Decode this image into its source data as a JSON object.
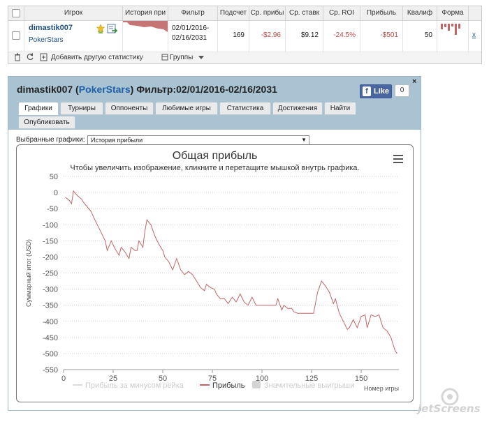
{
  "table": {
    "headers": [
      "Игрок",
      "История при",
      "Фильтр",
      "Подсчет",
      "Ср. прибы",
      "Ср. ставк",
      "Ср. ROI",
      "Прибыль",
      "Квалиф",
      "Форма"
    ],
    "row": {
      "player": "dimastik007",
      "site": "PokerStars",
      "filter_line1": "02/01/2016-",
      "filter_line2": "02/16/2031",
      "count": "169",
      "avg_profit": "-$2.96",
      "avg_stake": "$9.12",
      "avg_roi": "-24.5%",
      "profit": "-$501",
      "qual": "50",
      "remove": "x"
    },
    "footer": {
      "add_stat": "Добавить другую статистику",
      "groups": "Группы"
    }
  },
  "window": {
    "title_player": "dimastik007",
    "title_open": " (",
    "title_site": "PokerStars",
    "title_close": ") Фильтр:02/01/2016-02/16/2031",
    "fb_like": "Like",
    "fb_count": "0",
    "close": "×",
    "tabs": [
      "Графики",
      "Турниры",
      "Оппоненты",
      "Любимые игры",
      "Статистика",
      "Достижения",
      "Найти",
      "Опубликовать"
    ],
    "select_label": "Выбранные графики:",
    "select_value": "История прибыли"
  },
  "colors": {
    "series_line": "#c06666",
    "header_bg": "#a9c3d3",
    "accent_link": "#1e5fa8"
  },
  "chart_data": {
    "type": "line",
    "title": "Общая прибыль",
    "subtitle": "Чтобы увеличить изображение, кликните и перетащите мышкой внутрь графика.",
    "ylabel": "Суммарный итог (USD)",
    "xlabel": "Номер игры",
    "xlim": [
      0,
      169
    ],
    "ylim": [
      -550,
      50
    ],
    "xticks": [
      0,
      25,
      50,
      75,
      100,
      125,
      150
    ],
    "yticks": [
      50,
      0,
      -50,
      -100,
      -150,
      -200,
      -250,
      -300,
      -350,
      -400,
      -450,
      -500,
      -550
    ],
    "grid": "horizontal dotted",
    "legend": "bottom-center",
    "legend_items": [
      {
        "name": "Прибыль за минусом рейка",
        "visible": false
      },
      {
        "name": "Прибыль",
        "visible": true
      },
      {
        "name": "Значительные выигрыши",
        "visible": false
      }
    ],
    "series": [
      {
        "name": "Прибыль",
        "points": [
          [
            1,
            -15
          ],
          [
            3,
            -25
          ],
          [
            4,
            -35
          ],
          [
            5,
            5
          ],
          [
            7,
            -10
          ],
          [
            9,
            -20
          ],
          [
            10,
            -30
          ],
          [
            12,
            -45
          ],
          [
            14,
            -60
          ],
          [
            15,
            -75
          ],
          [
            17,
            -100
          ],
          [
            19,
            -125
          ],
          [
            21,
            -150
          ],
          [
            22,
            -180
          ],
          [
            24,
            -150
          ],
          [
            26,
            -175
          ],
          [
            28,
            -195
          ],
          [
            29,
            -170
          ],
          [
            31,
            -185
          ],
          [
            33,
            -205
          ],
          [
            34,
            -170
          ],
          [
            36,
            -180
          ],
          [
            37,
            -180
          ],
          [
            38,
            -150
          ],
          [
            40,
            -170
          ],
          [
            41,
            -120
          ],
          [
            42,
            -85
          ],
          [
            44,
            -100
          ],
          [
            46,
            -135
          ],
          [
            48,
            -160
          ],
          [
            50,
            -180
          ],
          [
            51,
            -200
          ],
          [
            53,
            -215
          ],
          [
            55,
            -240
          ],
          [
            57,
            -205
          ],
          [
            59,
            -240
          ],
          [
            61,
            -255
          ],
          [
            63,
            -245
          ],
          [
            65,
            -255
          ],
          [
            67,
            -275
          ],
          [
            69,
            -295
          ],
          [
            71,
            -305
          ],
          [
            72,
            -285
          ],
          [
            74,
            -295
          ],
          [
            76,
            -300
          ],
          [
            77,
            -315
          ],
          [
            79,
            -330
          ],
          [
            81,
            -330
          ],
          [
            83,
            -345
          ],
          [
            85,
            -325
          ],
          [
            87,
            -340
          ],
          [
            89,
            -315
          ],
          [
            91,
            -340
          ],
          [
            93,
            -350
          ],
          [
            95,
            -325
          ],
          [
            97,
            -350
          ],
          [
            99,
            -350
          ],
          [
            101,
            -350
          ],
          [
            103,
            -350
          ],
          [
            105,
            -350
          ],
          [
            107,
            -350
          ],
          [
            108,
            -330
          ],
          [
            110,
            -365
          ],
          [
            111,
            -350
          ],
          [
            113,
            -360
          ],
          [
            115,
            -360
          ],
          [
            116,
            -370
          ],
          [
            118,
            -375
          ],
          [
            120,
            -375
          ],
          [
            122,
            -375
          ],
          [
            124,
            -375
          ],
          [
            126,
            -375
          ],
          [
            128,
            -310
          ],
          [
            130,
            -275
          ],
          [
            132,
            -290
          ],
          [
            134,
            -310
          ],
          [
            136,
            -345
          ],
          [
            137,
            -330
          ],
          [
            139,
            -375
          ],
          [
            141,
            -400
          ],
          [
            143,
            -425
          ],
          [
            144,
            -420
          ],
          [
            146,
            -395
          ],
          [
            148,
            -420
          ],
          [
            150,
            -385
          ],
          [
            152,
            -380
          ],
          [
            153,
            -420
          ],
          [
            155,
            -380
          ],
          [
            157,
            -385
          ],
          [
            159,
            -380
          ],
          [
            161,
            -420
          ],
          [
            163,
            -430
          ],
          [
            165,
            -450
          ],
          [
            166,
            -470
          ],
          [
            167,
            -490
          ],
          [
            168,
            -500
          ]
        ]
      }
    ]
  }
}
